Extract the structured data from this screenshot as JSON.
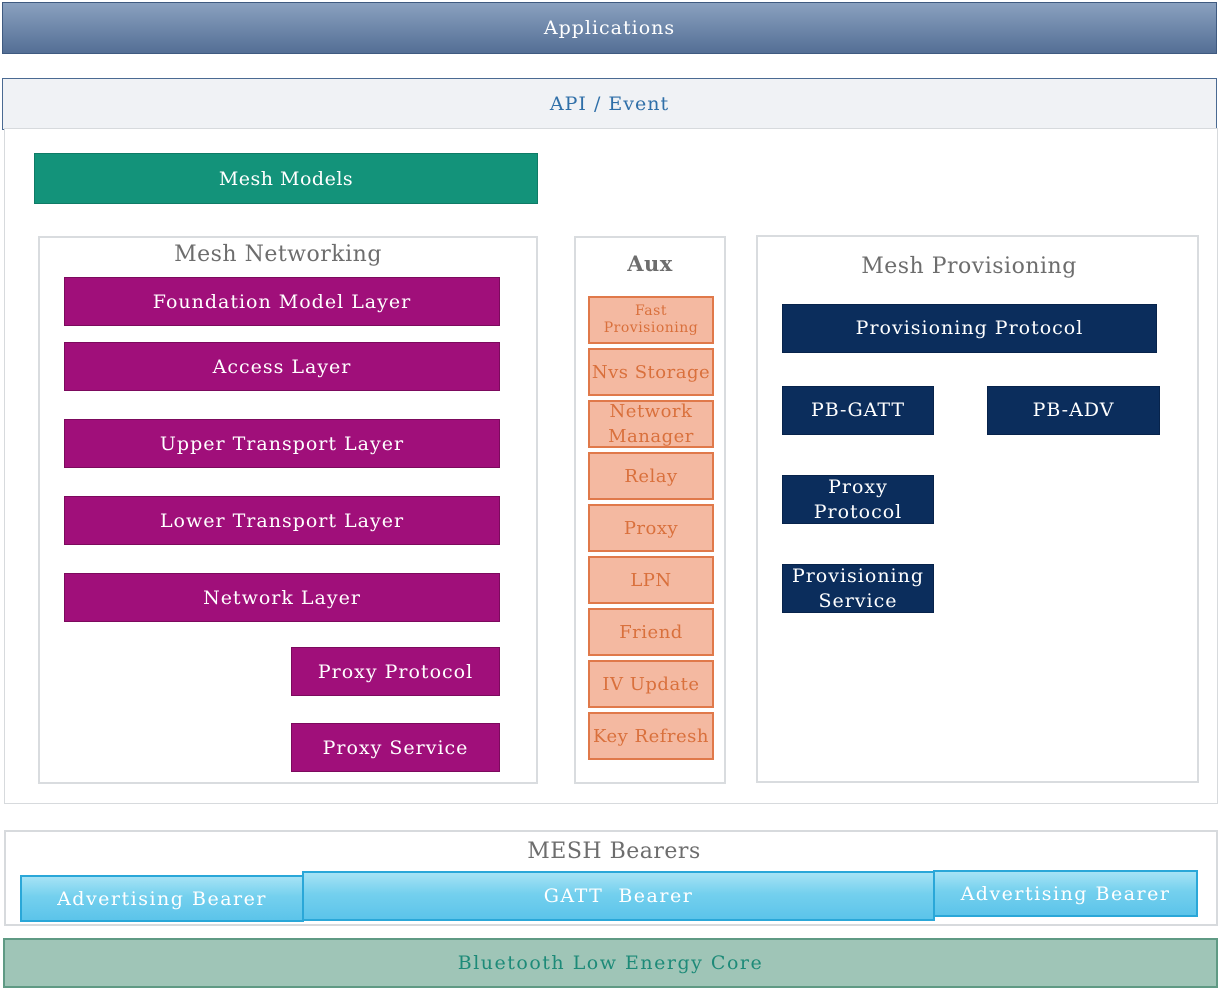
{
  "top": {
    "applications": "Applications",
    "api_event": "API / Event"
  },
  "mesh_models": "Mesh Models",
  "networking": {
    "title": "Mesh Networking",
    "layers": [
      "Foundation Model Layer",
      "Access Layer",
      "Upper Transport Layer",
      "Lower Transport Layer",
      "Network Layer",
      "Proxy Protocol",
      "Proxy Service"
    ]
  },
  "aux": {
    "title": "Aux",
    "items": [
      "Fast Provisioning",
      "Nvs Storage",
      "Network Manager",
      "Relay",
      "Proxy",
      "LPN",
      "Friend",
      "IV Update",
      "Key Refresh"
    ]
  },
  "provisioning": {
    "title": "Mesh Provisioning",
    "items": [
      "Provisioning Protocol",
      "PB-GATT",
      "PB-ADV",
      "Proxy Protocol",
      "Provisioning Service"
    ]
  },
  "bearers": {
    "title": "MESH Bearers",
    "items": [
      "Advertising Bearer",
      "GATT  Bearer",
      "Advertising Bearer"
    ]
  },
  "ble_core": "Bluetooth Low Energy Core",
  "colors": {
    "applications": "#6c85a8",
    "mesh_models": "#13937a",
    "networking_layer": "#a00f7a",
    "aux_item": "#f4b9a1",
    "provisioning_item": "#0b2d5c",
    "bearer": "#74d0ee",
    "ble_core": "#9fc5b7"
  }
}
